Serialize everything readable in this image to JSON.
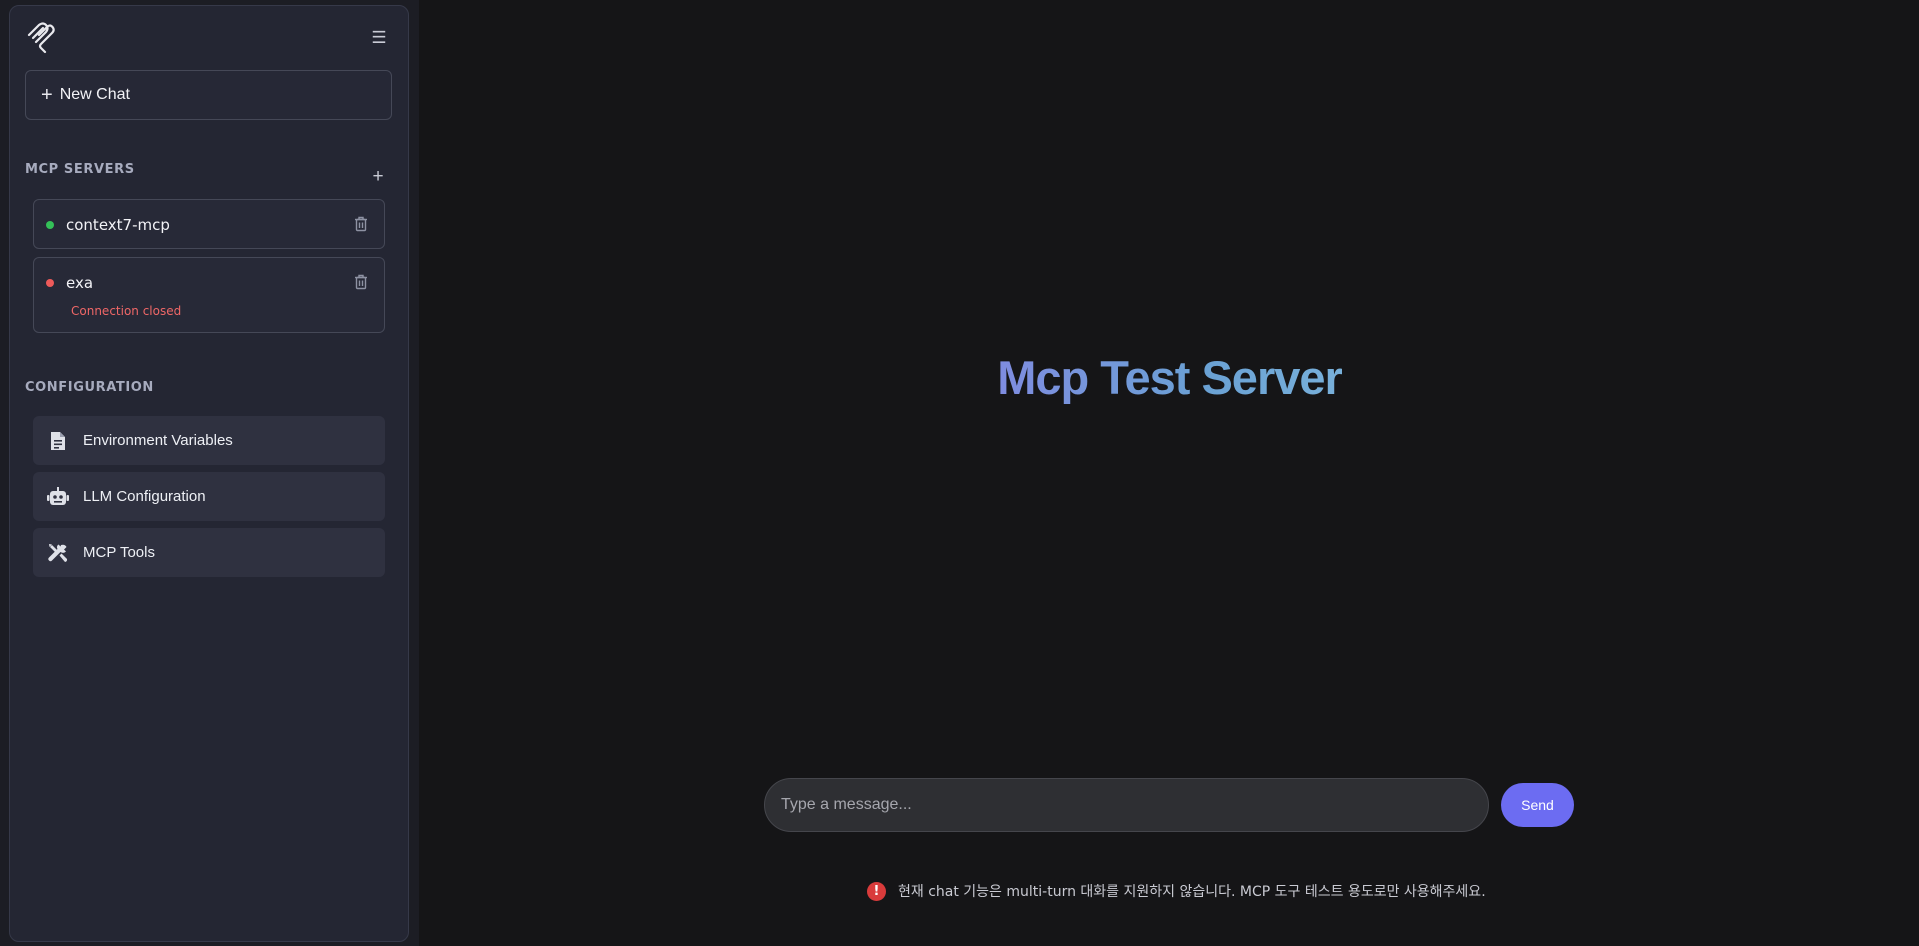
{
  "sidebar": {
    "new_chat_label": "New Chat",
    "mcp_servers_title": "MCP SERVERS",
    "servers": [
      {
        "name": "context7-mcp",
        "status": "connected",
        "status_color": "#34c058",
        "error": ""
      },
      {
        "name": "exa",
        "status": "error",
        "status_color": "#ee5a5a",
        "error": "Connection closed"
      }
    ],
    "configuration_title": "CONFIGURATION",
    "config_items": [
      {
        "label": "Environment Variables",
        "icon": "document-icon"
      },
      {
        "label": "LLM Configuration",
        "icon": "robot-icon"
      },
      {
        "label": "MCP Tools",
        "icon": "tools-icon"
      }
    ]
  },
  "main": {
    "title": "Mcp Test Server",
    "input_placeholder": "Type a message...",
    "send_label": "Send",
    "notice": "현재 chat 기능은 multi-turn 대화를 지원하지 않습니다. MCP 도구 테스트 용도로만 사용해주세요."
  },
  "colors": {
    "accent": "#6c6cf2",
    "title_gradient_start": "#7f8ce0",
    "title_gradient_end": "#78b0da",
    "error": "#ef6767"
  }
}
